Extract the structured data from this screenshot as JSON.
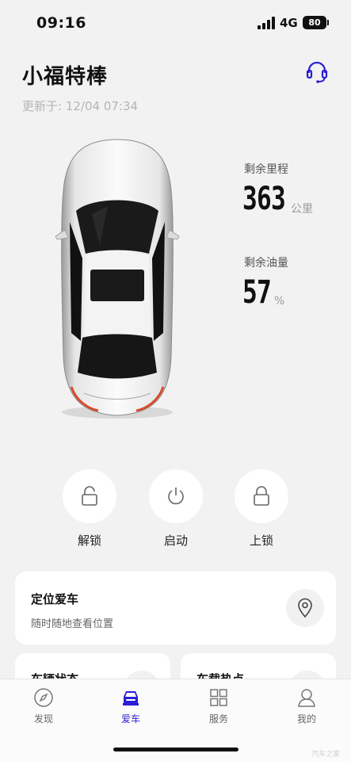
{
  "status_bar": {
    "time": "09:16",
    "network": "4G",
    "battery": "80"
  },
  "header": {
    "car_name": "小福特棒",
    "updated": "更新于: 12/04 07:34"
  },
  "stats": {
    "range": {
      "label": "剩余里程",
      "value": "363",
      "unit": "公里"
    },
    "fuel": {
      "label": "剩余油量",
      "value": "57",
      "unit": "%"
    }
  },
  "controls": [
    {
      "label": "解锁",
      "icon": "unlock-icon"
    },
    {
      "label": "启动",
      "icon": "power-icon"
    },
    {
      "label": "上锁",
      "icon": "lock-icon"
    }
  ],
  "cards": {
    "locate": {
      "title": "定位爱车",
      "subtitle": "随时随地查看位置",
      "icon": "location-pin-icon"
    },
    "vehicle_status": {
      "title": "车辆状态"
    },
    "hotspot": {
      "title": "车载热点"
    }
  },
  "tabs": [
    {
      "label": "发现",
      "icon": "compass-icon",
      "active": false
    },
    {
      "label": "爱车",
      "icon": "car-icon",
      "active": true
    },
    {
      "label": "服务",
      "icon": "grid-icon",
      "active": false
    },
    {
      "label": "我的",
      "icon": "person-icon",
      "active": false
    }
  ],
  "watermark": "汽车之家",
  "colors": {
    "accent": "#2a1fd6",
    "background": "#f2f2f2",
    "card": "#ffffff"
  }
}
